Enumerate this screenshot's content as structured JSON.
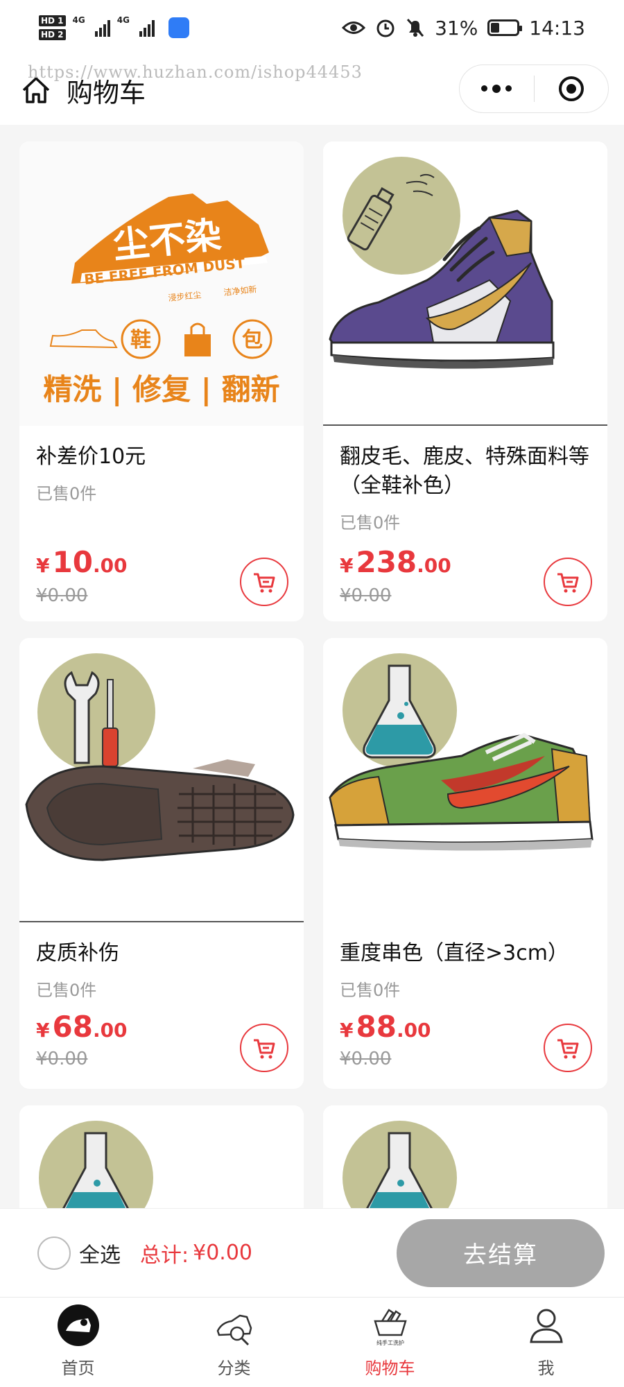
{
  "status_bar": {
    "hd1": "HD 1",
    "hd2": "HD 2",
    "net1": "4G",
    "net2": "4G",
    "battery": "31%",
    "battery_level": 0.31,
    "time": "14:13"
  },
  "header": {
    "title": "购物车",
    "watermark": "https://www.huzhan.com/ishop44453"
  },
  "banner": {
    "brand": "尘不染",
    "slogan": "BE FREE FROM DUST",
    "sub_left": "浸步红尘",
    "sub_right": "洁净如新",
    "icon_shoe": "鞋",
    "icon_bag": "包",
    "services": "精洗 | 修复 | 翻新"
  },
  "products": [
    {
      "name": "补差价10元",
      "sold": "已售0件",
      "yen": "¥",
      "price_int": "10",
      "price_dec": ".00",
      "original": "¥0.00",
      "image": "banner-logo"
    },
    {
      "name": "翻皮毛、鹿皮、特殊面料等（全鞋补色）",
      "sold": "已售0件",
      "yen": "¥",
      "price_int": "238",
      "price_dec": ".00",
      "original": "¥0.00",
      "image": "spray-sneaker"
    },
    {
      "name": "皮质补伤",
      "sold": "已售0件",
      "yen": "¥",
      "price_int": "68",
      "price_dec": ".00",
      "original": "¥0.00",
      "image": "tools-sole"
    },
    {
      "name": "重度串色（直径>3cm）",
      "sold": "已售0件",
      "yen": "¥",
      "price_int": "88",
      "price_dec": ".00",
      "original": "¥0.00",
      "image": "flask-sneaker"
    },
    {
      "name": "",
      "image": "flask"
    },
    {
      "name": "",
      "image": "flask"
    }
  ],
  "checkout": {
    "select_all": "全选",
    "total_label": "总计:",
    "total_value": "¥0.00",
    "button": "去结算"
  },
  "tabs": [
    {
      "label": "首页",
      "icon": "home-logo-icon"
    },
    {
      "label": "分类",
      "icon": "shoe-magnifier-icon"
    },
    {
      "label": "购物车",
      "icon": "shopping-basket-icon",
      "active": true,
      "caption": "纯手工洗护"
    },
    {
      "label": "我",
      "icon": "user-icon"
    }
  ],
  "colors": {
    "accent": "#e8383d",
    "brand_orange": "#e8841a",
    "checkout_button": "#a7a7a7",
    "icon_circle": "#c3c295"
  }
}
